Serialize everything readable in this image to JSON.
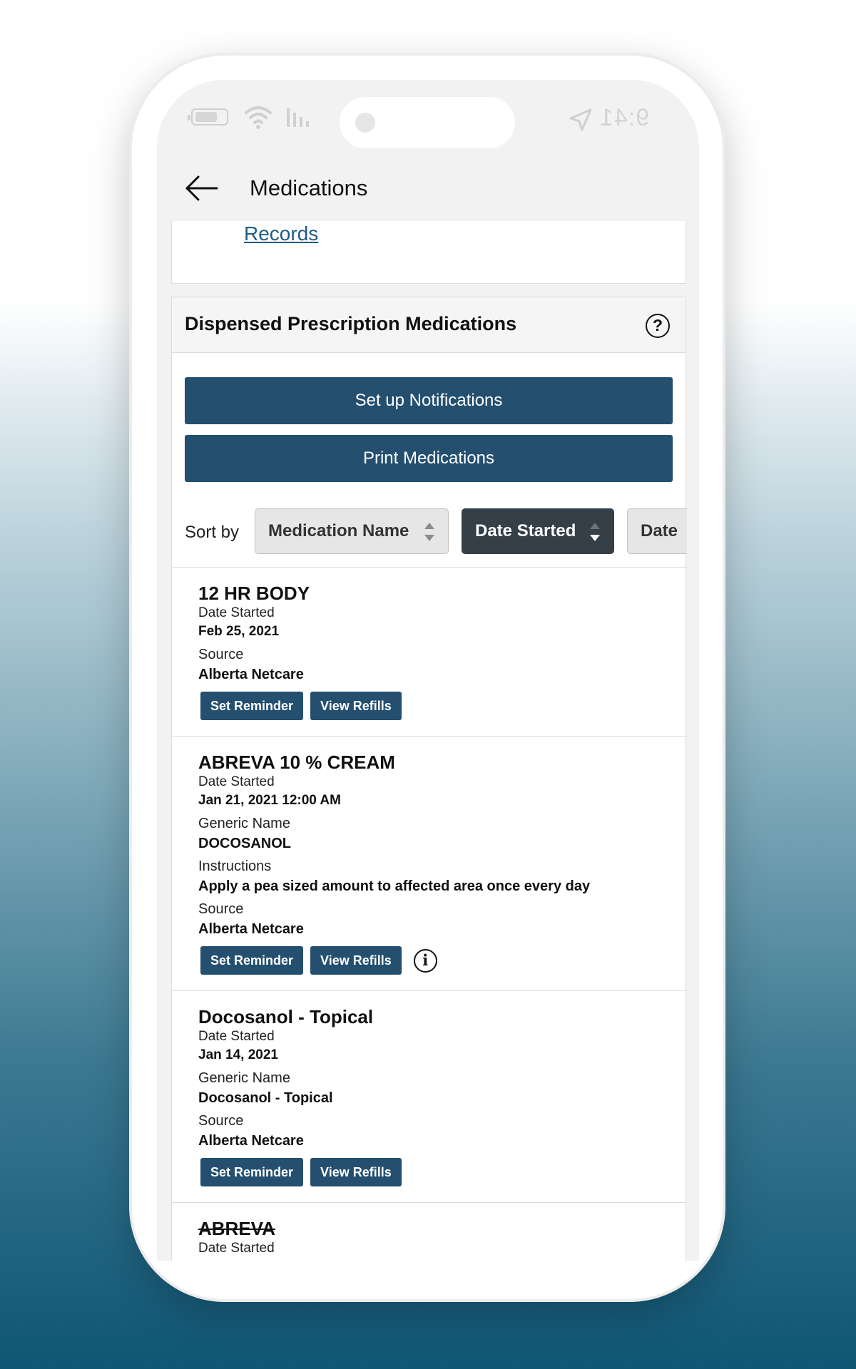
{
  "status_bar": {
    "time": "9:41"
  },
  "header": {
    "title": "Medications"
  },
  "records_card": {
    "link_text": "Records"
  },
  "dispensed": {
    "title": "Dispensed Prescription Medications",
    "notify_label": "Set up Notifications",
    "print_label": "Print Medications"
  },
  "sort": {
    "label": "Sort by",
    "options": [
      "Medication Name",
      "Date Started",
      "Date"
    ],
    "active": "Date Started"
  },
  "medications": [
    {
      "name": "12 HR BODY",
      "date_label": "Date Started",
      "date": "Feb 25, 2021",
      "source_label": "Source",
      "source": "Alberta Netcare",
      "reminder_label": "Set Reminder",
      "refills_label": "View Refills"
    },
    {
      "name": "ABREVA 10 % CREAM",
      "date_label": "Date Started",
      "date": "Jan 21, 2021 12:00 AM",
      "generic_label": "Generic Name",
      "generic": "DOCOSANOL",
      "instructions_label": "Instructions",
      "instructions": "Apply a pea sized amount to affected area once every day",
      "source_label": "Source",
      "source": "Alberta Netcare",
      "reminder_label": "Set Reminder",
      "refills_label": "View Refills"
    },
    {
      "name": "Docosanol - Topical",
      "date_label": "Date Started",
      "date": "Jan 14, 2021",
      "generic_label": "Generic Name",
      "generic": "Docosanol - Topical",
      "source_label": "Source",
      "source": "Alberta Netcare",
      "reminder_label": "Set Reminder",
      "refills_label": "View Refills"
    },
    {
      "name": "ABREVA",
      "date_label": "Date Started"
    }
  ],
  "colors": {
    "primary_button": "#244f6f",
    "active_chip": "#343f47",
    "link": "#1f5b86"
  }
}
